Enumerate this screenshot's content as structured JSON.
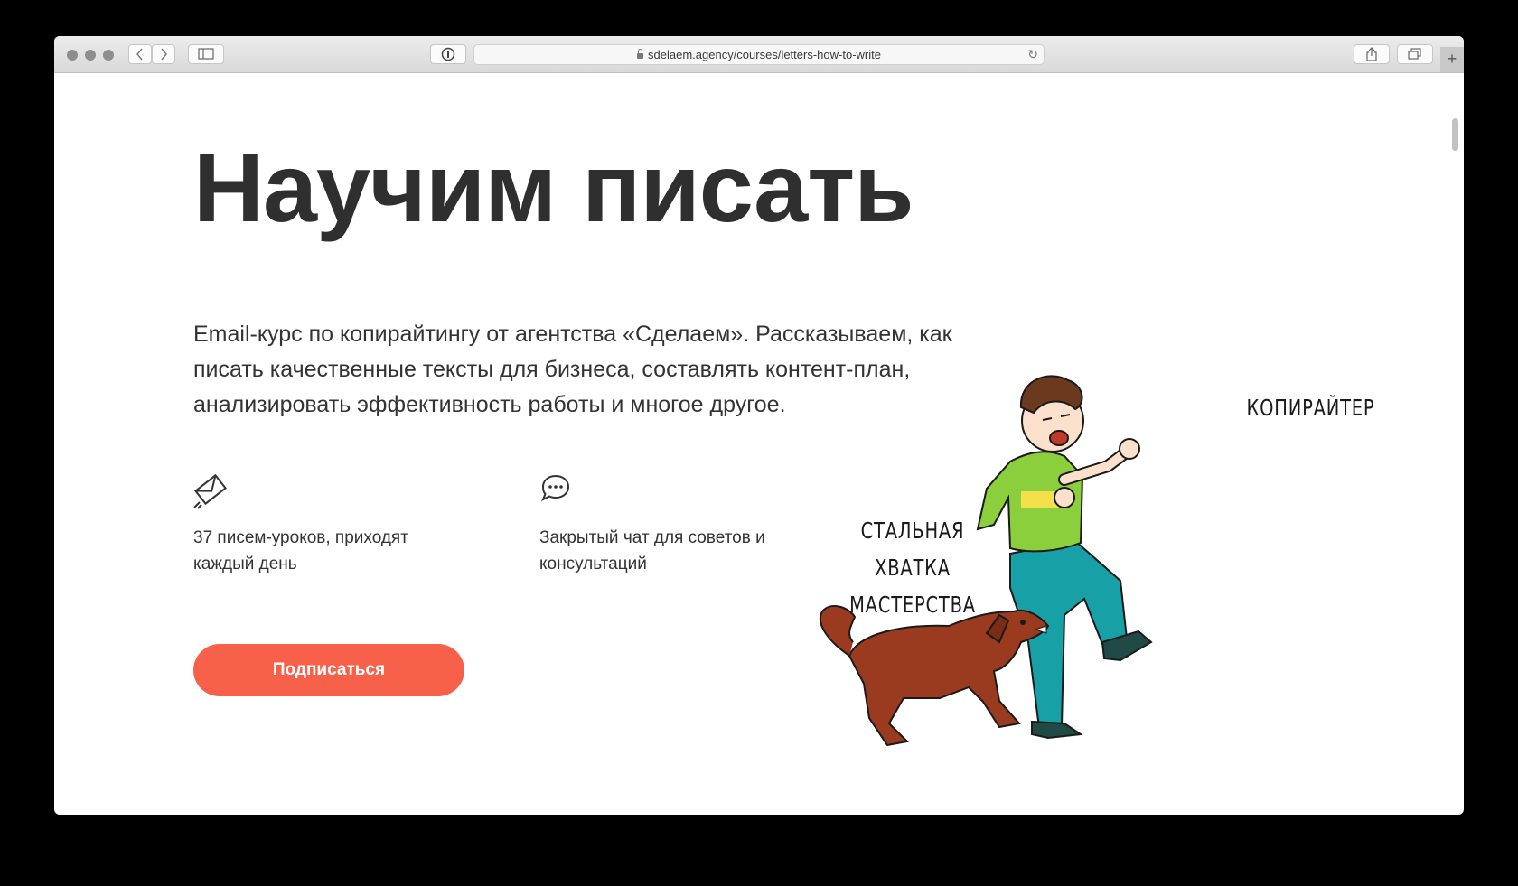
{
  "browser": {
    "url": "sdelaem.agency/courses/letters-how-to-write",
    "back_icon": "chevron-left-icon",
    "forward_icon": "chevron-right-icon",
    "new_tab_label": "+"
  },
  "hero": {
    "title": "Научим писать",
    "intro": "Email-курс по копирайтингу от агентства «Сделаем». Рассказываем, как писать качественные тексты для бизнеса, составлять контент-план, анализировать эффективность работы и многое другое.",
    "features": [
      {
        "icon": "envelope-icon",
        "text": "37 писем-уроков, приходят каждый день"
      },
      {
        "icon": "chat-bubble-icon",
        "text": "Закрытый чат для советов и консультаций"
      }
    ],
    "cta_label": "Подписаться"
  },
  "illustration": {
    "caption_left_line1": "СТАЛЬНАЯ ХВАТКА",
    "caption_left_line2": "МАСТЕРСТВА",
    "caption_right": "КОПИРАЙТЕР"
  },
  "colors": {
    "accent": "#F76049",
    "text": "#2F2F2F"
  }
}
